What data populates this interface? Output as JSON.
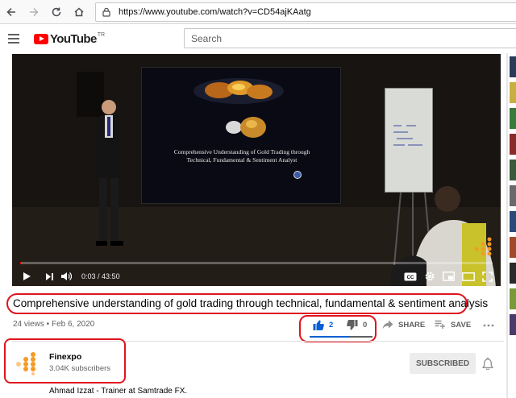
{
  "browser": {
    "url": "https://www.youtube.com/watch?v=CD54ajKAatg"
  },
  "header": {
    "logo_text": "YouTube",
    "logo_region": "TR",
    "search_placeholder": "Search"
  },
  "player": {
    "slide_text_line1": "Comprehensive Understanding of Gold Trading through",
    "slide_text_line2": "Technical, Fundamental & Sentiment Analyst",
    "time_current": "0:03",
    "time_separator": " / ",
    "time_total": "43:50",
    "progress_fraction": 0.001
  },
  "video": {
    "title": "Comprehensive understanding of gold trading through technical, fundamental & sentiment analysis",
    "views": "24 views",
    "bullet": " • ",
    "date": "Feb 6, 2020",
    "like_count": "2",
    "dislike_count": "0",
    "share_label": "SHARE",
    "save_label": "SAVE",
    "like_ratio": 1.0
  },
  "channel": {
    "name": "Finexpo",
    "subscribers": "3.04K subscribers",
    "subscribe_label": "SUBSCRIBED",
    "description": "Ahmad Izzat - Trainer at Samtrade FX."
  },
  "colors": {
    "youtube_red": "#ff0000",
    "annotation_red": "#e0141e",
    "like_blue": "#065fd4",
    "finexpo_orange": "#f59a23"
  },
  "icons": {
    "back": "arrow-left-icon",
    "forward": "arrow-right-icon",
    "reload": "reload-icon",
    "home": "home-icon",
    "lock": "lock-icon",
    "menu": "hamburger-icon",
    "play": "play-icon",
    "next": "skip-next-icon",
    "volume": "volume-icon",
    "captions": "cc-icon",
    "settings": "gear-icon",
    "miniplayer": "miniplayer-icon",
    "theater": "theater-icon",
    "fullscreen": "fullscreen-icon",
    "like": "thumbs-up-icon",
    "dislike": "thumbs-down-icon",
    "share": "share-icon",
    "save": "playlist-add-icon",
    "more": "more-icon",
    "bell": "bell-icon"
  }
}
